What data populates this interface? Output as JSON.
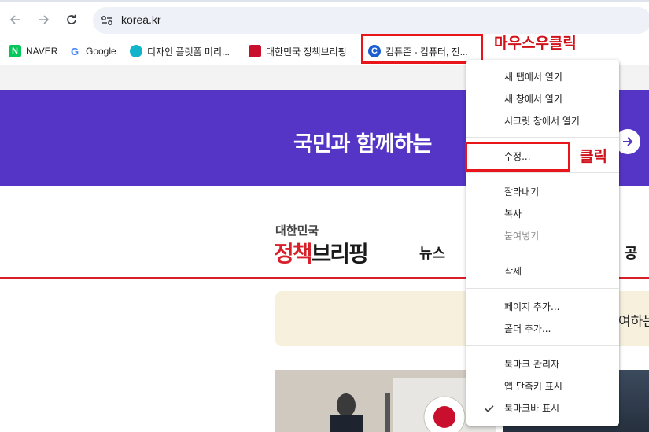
{
  "browser": {
    "url": "korea.kr",
    "back_icon": "arrow-left-icon",
    "forward_icon": "arrow-right-icon",
    "reload_icon": "reload-icon",
    "site_info_icon": "tune-icon"
  },
  "bookmarks": [
    {
      "label": "NAVER",
      "fav_text": "N",
      "fav_color": "#03c75a"
    },
    {
      "label": "Google",
      "fav_text": "G",
      "fav_color": "#4285f4"
    },
    {
      "label": "디자인 플랫폼 미리...",
      "fav_text": "",
      "fav_color": "#13b4c9"
    },
    {
      "label": "대한민국 정책브리핑",
      "fav_text": "",
      "fav_color": "#c8102e"
    },
    {
      "label": "컴퓨존 - 컴퓨터, 전...",
      "fav_text": "C",
      "fav_color": "#1a5fd0"
    }
  ],
  "annotations": {
    "right_click": "마우스우클릭",
    "click": "클릭"
  },
  "page": {
    "banner_text": "국민과 함께하는",
    "logo_small": "대한민국",
    "logo_big_a": "정책",
    "logo_big_b": "브리핑",
    "nav_news": "뉴스",
    "nav_clip": "- 공",
    "notice_text": "여하는"
  },
  "context_menu": {
    "items": [
      {
        "label": "새 탭에서 열기",
        "disabled": false
      },
      {
        "label": "새 창에서 열기",
        "disabled": false
      },
      {
        "label": "시크릿 창에서 열기",
        "disabled": false
      },
      {
        "label": "수정...",
        "disabled": false
      },
      {
        "label": "잘라내기",
        "disabled": false
      },
      {
        "label": "복사",
        "disabled": false
      },
      {
        "label": "붙여넣기",
        "disabled": true
      },
      {
        "label": "삭제",
        "disabled": false
      },
      {
        "label": "페이지 추가...",
        "disabled": false
      },
      {
        "label": "폴더 추가...",
        "disabled": false
      },
      {
        "label": "북마크 관리자",
        "disabled": false
      },
      {
        "label": "앱 단축키 표시",
        "disabled": false
      },
      {
        "label": "북마크바 표시",
        "disabled": false,
        "checked": true
      }
    ]
  },
  "colors": {
    "banner": "#5535c6",
    "accent_red": "#d8202a",
    "highlight": "#e8151b"
  }
}
